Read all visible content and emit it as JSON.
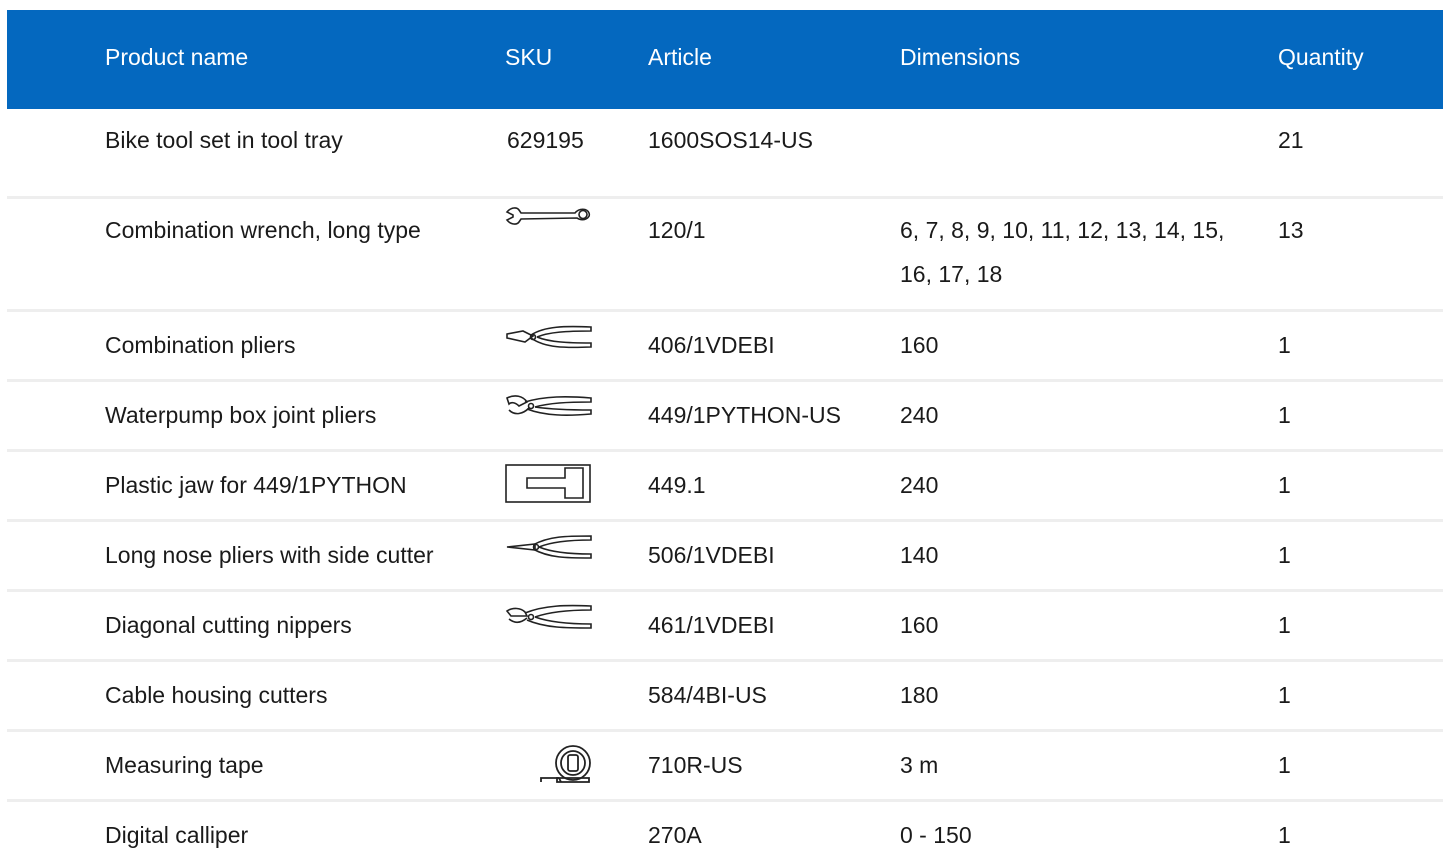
{
  "headers": {
    "product_name": "Product name",
    "sku": "SKU",
    "article": "Article",
    "dimensions": "Dimensions",
    "quantity": "Quantity"
  },
  "rows": [
    {
      "name": "Bike tool set in tool tray",
      "sku": "629195",
      "article": "1600SOS14-US",
      "dimensions": "",
      "quantity": "21",
      "image": "none"
    },
    {
      "name": "Combination wrench, long type",
      "sku": "",
      "article": "120/1",
      "dimensions": "6, 7, 8, 9, 10, 11, 12, 13, 14, 15, 16, 17, 18",
      "quantity": "13",
      "image": "combination-wrench-icon"
    },
    {
      "name": "Combination pliers",
      "sku": "",
      "article": "406/1VDEBI",
      "dimensions": "160",
      "quantity": "1",
      "image": "combination-pliers-icon"
    },
    {
      "name": "Waterpump box joint pliers",
      "sku": "",
      "article": "449/1PYTHON-US",
      "dimensions": "240",
      "quantity": "1",
      "image": "waterpump-pliers-icon"
    },
    {
      "name": "Plastic jaw for 449/1PYTHON",
      "sku": "",
      "article": "449.1",
      "dimensions": "240",
      "quantity": "1",
      "image": "plastic-jaw-icon"
    },
    {
      "name": "Long nose pliers with side cutter",
      "sku": "",
      "article": "506/1VDEBI",
      "dimensions": "140",
      "quantity": "1",
      "image": "long-nose-pliers-icon"
    },
    {
      "name": "Diagonal cutting nippers",
      "sku": "",
      "article": "461/1VDEBI",
      "dimensions": "160",
      "quantity": "1",
      "image": "diagonal-nippers-icon"
    },
    {
      "name": "Cable housing cutters",
      "sku": "",
      "article": "584/4BI-US",
      "dimensions": "180",
      "quantity": "1",
      "image": "none"
    },
    {
      "name": "Measuring tape",
      "sku": "",
      "article": "710R-US",
      "dimensions": "3 m",
      "quantity": "1",
      "image": "measuring-tape-icon"
    },
    {
      "name": "Digital calliper",
      "sku": "",
      "article": "270A",
      "dimensions": "0 - 150",
      "quantity": "1",
      "image": "none"
    }
  ],
  "colors": {
    "header_background": "#0468bf",
    "header_text": "#ffffff",
    "row_divider": "#eeeeee"
  }
}
